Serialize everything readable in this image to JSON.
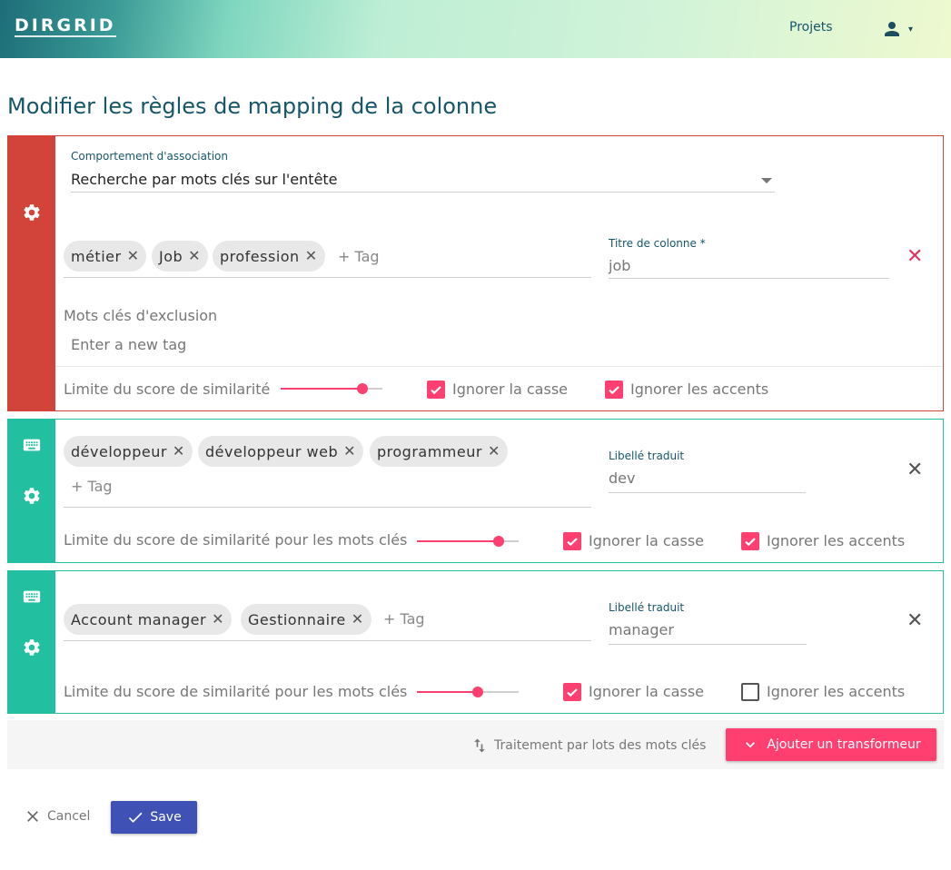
{
  "header": {
    "logo": "DIRGRID",
    "nav_projects": "Projets",
    "user_icon": "person-icon",
    "user_caret": "▾"
  },
  "page": {
    "title": "Modifier les règles de mapping de la colonne"
  },
  "rule_card": {
    "side_color": "#d2433a",
    "behavior_label": "Comportement d'association",
    "behavior_value": "Recherche par mots clés sur l'entête",
    "tags": [
      "métier",
      "Job",
      "profession"
    ],
    "add_tag": "+ Tag",
    "column_title_label": "Titre de colonne *",
    "column_title_value": "job",
    "exclusion_label": "Mots clés d'exclusion",
    "exclusion_placeholder": "Enter a new tag",
    "similarity_label": "Limite du score de similarité",
    "similarity_value": 0.8,
    "ignore_case_label": "Ignorer la casse",
    "ignore_case": true,
    "ignore_accents_label": "Ignorer les accents",
    "ignore_accents": true
  },
  "transformers": [
    {
      "side_color": "#22bfa0",
      "tags": [
        "développeur",
        "développeur web",
        "programmeur"
      ],
      "add_tag": "+ Tag",
      "translated_label": "Libellé traduit",
      "translated_value": "dev",
      "similarity_label": "Limite du score de similarité pour les mots clés",
      "similarity_value": 0.8,
      "ignore_case_label": "Ignorer la casse",
      "ignore_case": true,
      "ignore_accents_label": "Ignorer les accents",
      "ignore_accents": true
    },
    {
      "side_color": "#22bfa0",
      "tags": [
        "Account manager",
        "Gestionnaire"
      ],
      "add_tag": "+ Tag",
      "translated_label": "Libellé traduit",
      "translated_value": "manager",
      "similarity_label": "Limite du score de similarité pour les mots clés",
      "similarity_value": 0.6,
      "ignore_case_label": "Ignorer la casse",
      "ignore_case": true,
      "ignore_accents_label": "Ignorer les accents",
      "ignore_accents": false
    }
  ],
  "actions": {
    "batch_label": "Traitement par lots des mots clés",
    "add_transformer_label": "Ajouter un transformeur"
  },
  "footer": {
    "cancel_label": "Cancel",
    "save_label": "Save"
  },
  "colors": {
    "accent": "#ff3f6f",
    "primary": "#3f51b5",
    "title": "#17566a",
    "danger": "#e0335f"
  }
}
